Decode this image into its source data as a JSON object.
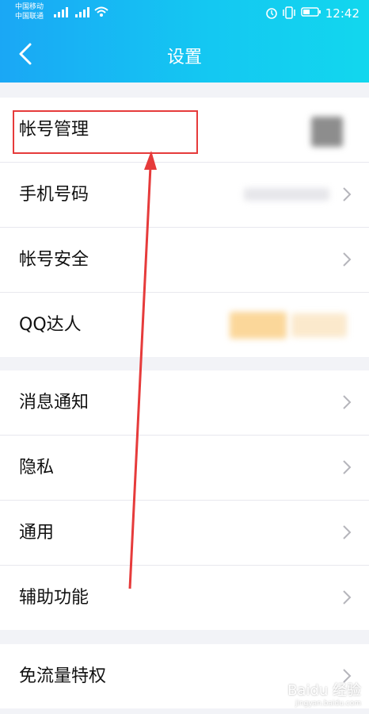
{
  "status": {
    "carrier1": "中国移动",
    "carrier2": "中国联通",
    "time": "12:42"
  },
  "header": {
    "title": "设置"
  },
  "sections": [
    {
      "rows": [
        {
          "label": "帐号管理"
        },
        {
          "label": "手机号码"
        },
        {
          "label": "帐号安全"
        },
        {
          "label": "QQ达人"
        }
      ]
    },
    {
      "rows": [
        {
          "label": "消息通知"
        },
        {
          "label": "隐私"
        },
        {
          "label": "通用"
        },
        {
          "label": "辅助功能"
        }
      ]
    },
    {
      "rows": [
        {
          "label": "免流量特权"
        }
      ]
    }
  ],
  "colors": {
    "accent": "#1aa7f5",
    "annotation": "#e63b3b"
  },
  "watermark": {
    "text": "Baidu 经验",
    "sub": "jingyan.baidu.com"
  }
}
